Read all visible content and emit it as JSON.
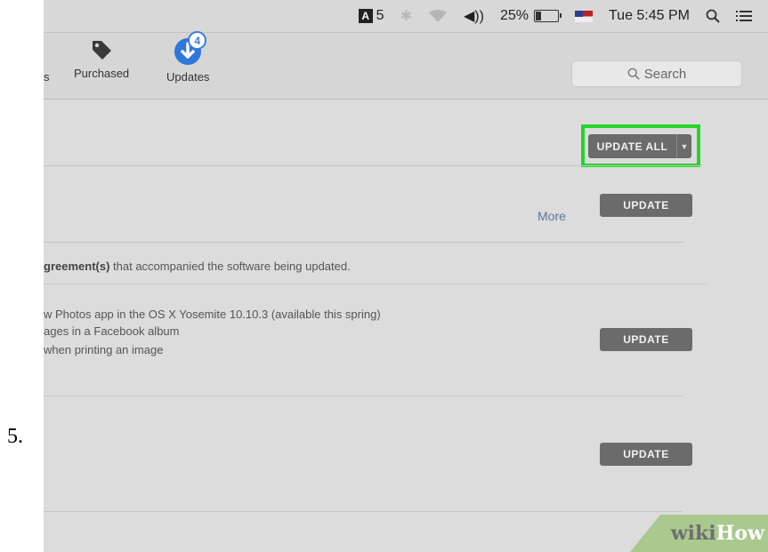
{
  "step": {
    "number": "5."
  },
  "menubar": {
    "adobe_count": "5",
    "volume": "◀))",
    "battery": "25%",
    "battery_level": 0.25,
    "clock": "Tue 5:45 PM"
  },
  "toolbar": {
    "tabs": [
      {
        "label": "s",
        "icon": "cropped-tab-icon"
      },
      {
        "label": "Purchased",
        "icon": "tag-icon"
      },
      {
        "label": "Updates",
        "icon": "download-icon",
        "badge": "4"
      }
    ],
    "search": {
      "placeholder": "Search"
    }
  },
  "content": {
    "update_all_label": "UPDATE ALL",
    "update_all_arrow": "▼",
    "highlight_color": "#22d52a",
    "more_link": "More",
    "license_prefix": "greement(s)",
    "license_text": " that accompanied the software being updated.",
    "notes": [
      "w Photos app in the OS X Yosemite 10.10.3 (available this spring)",
      "ages in a Facebook album",
      " when printing an image"
    ],
    "update_label": "UPDATE"
  },
  "watermark": {
    "part1": "wiki",
    "part2": "How"
  }
}
